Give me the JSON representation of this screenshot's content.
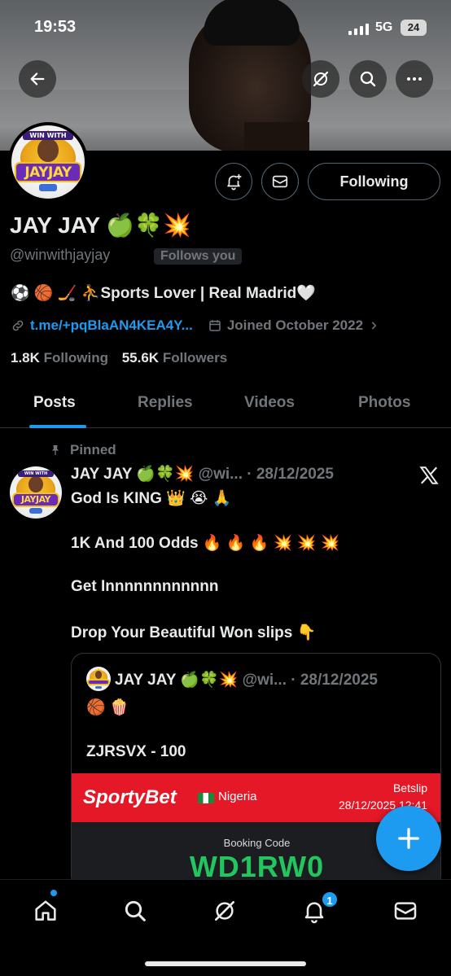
{
  "status_bar": {
    "time": "19:53",
    "network": "5G",
    "battery": "24"
  },
  "profile": {
    "logo_top_text": "WIN WITH",
    "logo_main_text": "JAYJAY",
    "name": "JAY JAY 🍏🍀💥",
    "handle": "@winwithjayjay",
    "follows_you": "Follows you",
    "bio": "⚽️ 🏀 🏒 ⛹️Sports Lover | Real Madrid🤍",
    "link": "t.me/+pqBlaAN4KEA4Y...",
    "joined": "Joined October 2022",
    "following_count": "1.8K",
    "following_label": "Following",
    "followers_count": "55.6K",
    "followers_label": "Followers",
    "follow_button": "Following"
  },
  "tabs": [
    {
      "label": "Posts"
    },
    {
      "label": "Replies"
    },
    {
      "label": "Videos"
    },
    {
      "label": "Photos"
    }
  ],
  "post": {
    "pinned_label": "Pinned",
    "author_name": "JAY JAY 🍏🍀💥",
    "author_meta": "@wi... · 28/12/2025",
    "lines": [
      "God Is KING 👑 😭 🙏",
      "1K And 100 Odds 🔥 🔥 🔥 💥 💥 💥",
      "Get Innnnnnnnnnnn",
      "Drop Your Beautiful Won slips 👇"
    ],
    "quote": {
      "author_name": "JAY JAY 🍏🍀💥",
      "author_meta": "@wi... · 28/12/2025",
      "emoji_line": "🏀 🍿",
      "code_line": "ZJRSVX - 100",
      "brand": "SportyBet",
      "country": "Nigeria",
      "betslip_label": "Betslip",
      "betslip_date": "28/12/2025 12:41",
      "booking_label": "Booking Code",
      "booking_code": "WD1RW0"
    }
  },
  "nav": {
    "notification_count": "1"
  },
  "colors": {
    "accent": "#1d9bf0",
    "muted": "#71767b",
    "sporty_red": "#e41827",
    "code_green": "#22c55e"
  }
}
